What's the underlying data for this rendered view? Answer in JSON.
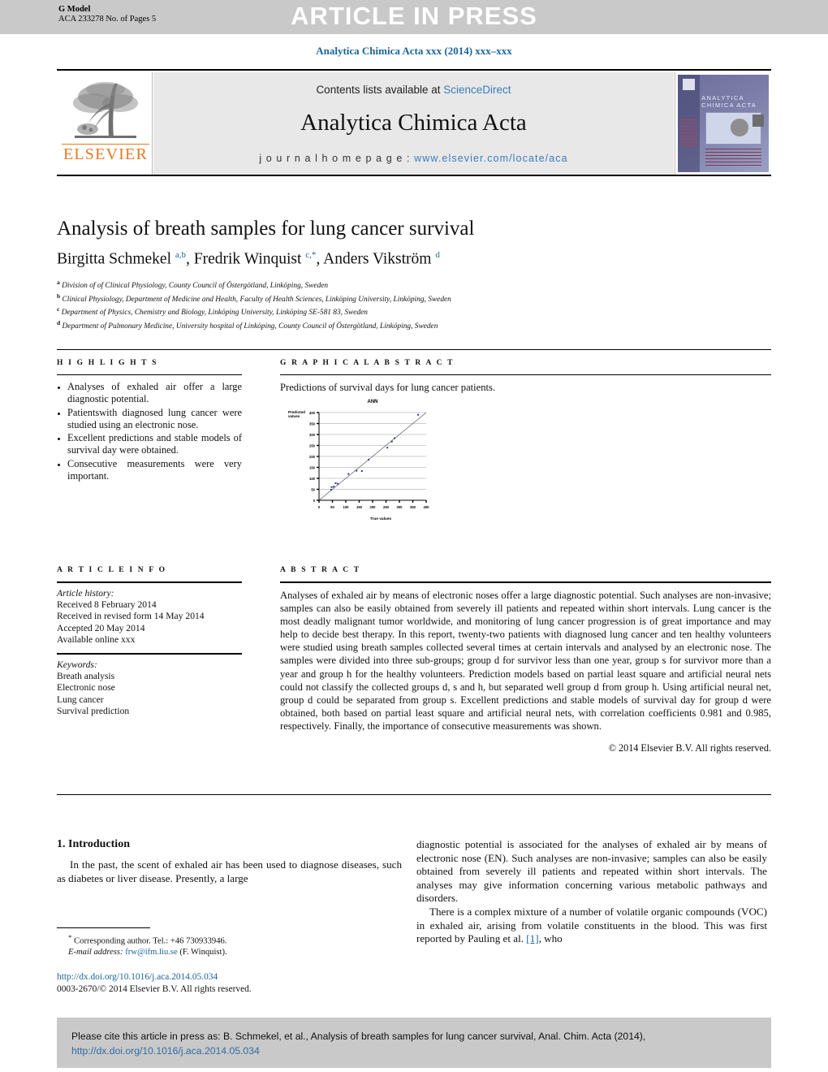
{
  "press_band": {
    "banner": "ARTICLE IN PRESS",
    "g_model": "G Model",
    "g_model_id": "ACA 233278 No. of Pages 5"
  },
  "running_head": "Analytica Chimica Acta xxx (2014) xxx–xxx",
  "masthead": {
    "publisher": "ELSEVIER",
    "contents_prefix": "Contents lists available at ",
    "contents_link": "ScienceDirect",
    "journal_title": "Analytica Chimica Acta",
    "homepage_label": "j o u r n a l   h o m e p a g e :",
    "homepage_url": "www.elsevier.com/locate/aca",
    "cover_title_line1": "ANALYTICA",
    "cover_title_line2": "CHIMICA ACTA"
  },
  "article": {
    "title": "Analysis of breath samples for lung cancer survival",
    "authors_html": "Birgitta Schmekel <sup>a,b</sup>, Fredrik Winquist <sup>c,*</sup>, Anders Vikström <sup>d</sup>",
    "affiliations": [
      {
        "mark": "a",
        "text": "Division of of Clinical Physiology, County Council of Östergötland, Linköping, Sweden"
      },
      {
        "mark": "b",
        "text": "Clinical Physiology, Department of Medicine and Health, Faculty of Health Sciences, Linköping University, Linköping, Sweden"
      },
      {
        "mark": "c",
        "text": "Department of Physics, Chemistry and Biology, Linköping University, Linköping SE-581 83, Sweden"
      },
      {
        "mark": "d",
        "text": "Department of Pulmonary Medicine, University hospital of Linköping, County Council of Östergötland, Linköping, Sweden"
      }
    ]
  },
  "highlights": {
    "label": "H I G H L I G H T S",
    "items": [
      "Analyses of exhaled air offer a large diagnostic potential.",
      "Patientswith diagnosed lung cancer were studied using an electronic nose.",
      "Excellent predictions and stable models of survival day were obtained.",
      "Consecutive measurements were very important."
    ]
  },
  "graphical_abstract": {
    "label": "G R A P H I C A L   A B S T R A C T",
    "caption": "Predictions of survival days for lung cancer patients."
  },
  "chart_data": {
    "type": "scatter",
    "title": "ANN",
    "xlabel": "True values",
    "ylabel": "Predicted values",
    "xlim": [
      0,
      400
    ],
    "ylim": [
      0,
      400
    ],
    "xticks": [
      0,
      50,
      100,
      150,
      200,
      250,
      300,
      350,
      400
    ],
    "yticks": [
      0,
      50,
      100,
      150,
      200,
      250,
      300,
      350,
      400
    ],
    "grid": "horizontal",
    "point_color": "#2b3a8f",
    "reference_line": {
      "label": "y = x",
      "from": [
        0,
        0
      ],
      "to": [
        400,
        400
      ]
    },
    "points": [
      {
        "x": 45,
        "y": 48
      },
      {
        "x": 47,
        "y": 60
      },
      {
        "x": 55,
        "y": 62
      },
      {
        "x": 62,
        "y": 78
      },
      {
        "x": 70,
        "y": 75
      },
      {
        "x": 110,
        "y": 120
      },
      {
        "x": 140,
        "y": 135
      },
      {
        "x": 160,
        "y": 133
      },
      {
        "x": 185,
        "y": 185
      },
      {
        "x": 255,
        "y": 240
      },
      {
        "x": 272,
        "y": 268
      },
      {
        "x": 282,
        "y": 283
      },
      {
        "x": 370,
        "y": 390
      }
    ]
  },
  "article_info": {
    "label": "A R T I C L E   I N F O",
    "history_label": "Article history:",
    "history": [
      "Received 8 February 2014",
      "Received in revised form 14 May 2014",
      "Accepted 20 May 2014",
      "Available online xxx"
    ],
    "keywords_label": "Keywords:",
    "keywords": [
      "Breath analysis",
      "Electronic nose",
      "Lung cancer",
      "Survival prediction"
    ]
  },
  "abstract": {
    "label": "A B S T R A C T",
    "text": "Analyses of exhaled air by means of electronic noses offer a large diagnostic potential. Such analyses are non-invasive; samples can also be easily obtained from severely ill patients and repeated within short intervals. Lung cancer is the most deadly malignant tumor worldwide, and monitoring of lung cancer progression is of great importance and may help to decide best therapy. In this report, twenty-two patients with diagnosed lung cancer and ten healthy volunteers were studied using breath samples collected several times at certain intervals and analysed by an electronic nose. The samples were divided into three sub-groups; group d for survivor less than one year, group s for survivor more than a year and group h for the healthy volunteers. Prediction models based on partial least square and artificial neural nets could not classify the collected groups d, s and h, but separated well group d from group h. Using artificial neural net, group d could be separated from group s. Excellent predictions and stable models of survival day for group d were obtained, both based on partial least square and artificial neural nets, with correlation coefficients 0.981 and 0.985, respectively. Finally, the importance of consecutive measurements was shown.",
    "copyright": "© 2014 Elsevier B.V. All rights reserved."
  },
  "introduction": {
    "heading": "1. Introduction",
    "left_para": "In the past, the scent of exhaled air has been used to diagnose diseases, such as diabetes or liver disease. Presently, a large",
    "right_para_1": "diagnostic potential is associated for the analyses of exhaled air by means of electronic nose (EN). Such analyses are non-invasive; samples can also be easily obtained from severely ill patients and repeated within short intervals. The analyses may give information concerning various metabolic pathways and disorders.",
    "right_para_2_pre": "There is a complex mixture of a number of volatile organic compounds (VOC) in exhaled air, arising from volatile constituents in the blood. This was first reported by Pauling et al. ",
    "right_para_2_ref": "[1]",
    "right_para_2_post": ", who"
  },
  "footnote": {
    "corresponding": "Corresponding author. Tel.: +46 730933946.",
    "email_label": "E-mail address:",
    "email": "frw@ifm.liu.se",
    "email_owner": "(F. Winquist)."
  },
  "doi_block": {
    "doi_url": "http://dx.doi.org/10.1016/j.aca.2014.05.034",
    "issn_line": "0003-2670/© 2014 Elsevier B.V. All rights reserved."
  },
  "cite_box": {
    "text": "Please cite this article in press as: B. Schmekel, et al., Analysis of breath samples for lung cancer survival, Anal. Chim. Acta (2014), ",
    "link": "http://dx.doi.org/10.1016/j.aca.2014.05.034"
  },
  "colors": {
    "link": "#1a6496",
    "band": "#c9c9c9",
    "elsevier_orange": "#E87722"
  }
}
